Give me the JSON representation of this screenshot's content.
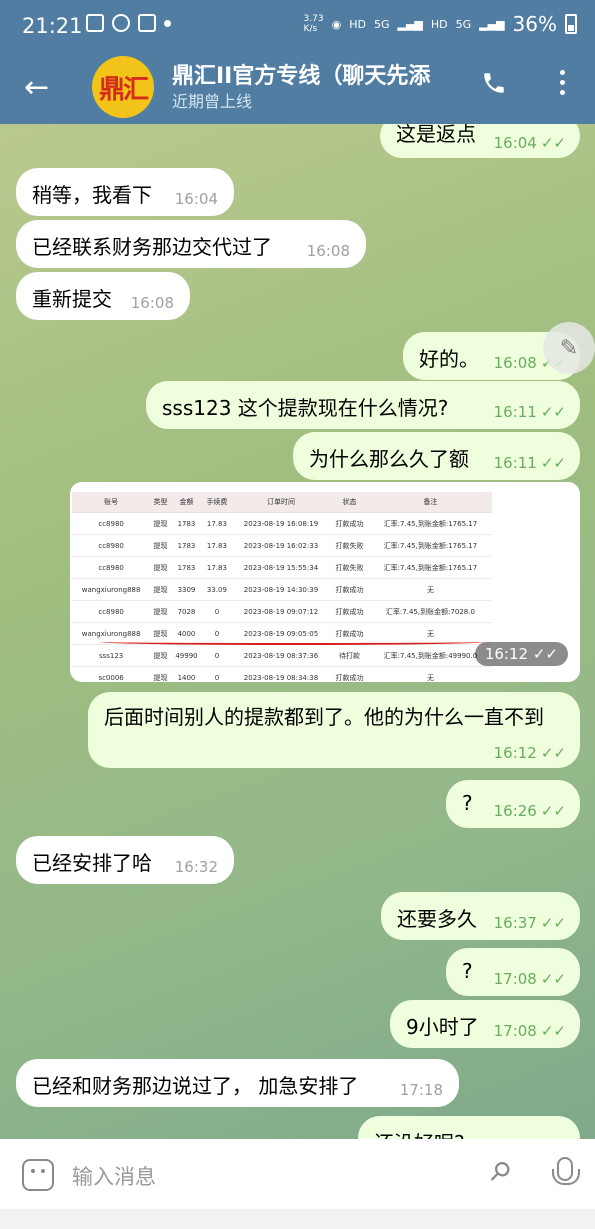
{
  "status_bar": {
    "time": "21:21",
    "net_speed": "3.73\nK/s",
    "hd1": "HD",
    "g5": "5G",
    "hd2": "HD",
    "g5b": "5G",
    "battery": "36%"
  },
  "header": {
    "title": "鼎汇II官方专线（聊天先添",
    "subtitle": "近期曾上线",
    "avatar_text": "鼎汇"
  },
  "colors": {
    "header": "#517da2",
    "out_bubble": "#effedd",
    "in_bubble": "#ffffff",
    "read_tick": "#6aac5e"
  },
  "messages": [
    {
      "dir": "out",
      "text": "这是返点",
      "time": "16:04"
    },
    {
      "dir": "in",
      "text": "稍等，我看下",
      "time": "16:04"
    },
    {
      "dir": "in",
      "text": "已经联系财务那边交代过了",
      "time": "16:08"
    },
    {
      "dir": "in",
      "text": "重新提交",
      "time": "16:08"
    },
    {
      "dir": "out",
      "text": "好的。",
      "time": "16:08"
    },
    {
      "dir": "out",
      "text": "sss123 这个提款现在什么情况?",
      "time": "16:11"
    },
    {
      "dir": "out",
      "text": "为什么那么久了额",
      "time": "16:11"
    },
    {
      "dir": "out",
      "text": "",
      "time": "16:12",
      "type": "image"
    },
    {
      "dir": "out",
      "text": "后面时间别人的提款都到了。他的为什么一直不到",
      "time": "16:12"
    },
    {
      "dir": "out",
      "text": "?",
      "time": "16:26"
    },
    {
      "dir": "in",
      "text": "已经安排了哈",
      "time": "16:32"
    },
    {
      "dir": "out",
      "text": "还要多久",
      "time": "16:37"
    },
    {
      "dir": "out",
      "text": "?",
      "time": "17:08"
    },
    {
      "dir": "out",
      "text": "9小时了",
      "time": "17:08"
    },
    {
      "dir": "in",
      "text": "已经和财务那边说过了， 加急安排了",
      "time": "17:18"
    },
    {
      "dir": "out",
      "text": "还没好呢?",
      "time": ""
    }
  ],
  "image_table": {
    "headers": [
      "账号",
      "类型",
      "金额",
      "手续费",
      "订单时间",
      "状态",
      "备注"
    ],
    "rows": [
      [
        "cc8980",
        "提现",
        "1783",
        "17.83",
        "2023-08-19 16:08:19",
        "打款成功",
        "汇率:7.45,到账金额:1765.17"
      ],
      [
        "cc8980",
        "提现",
        "1783",
        "17.83",
        "2023-08-19 16:02:33",
        "打款失败",
        "汇率:7.45,到账金额:1765.17"
      ],
      [
        "cc8980",
        "提现",
        "1783",
        "17.83",
        "2023-08-19 15:55:34",
        "打款失败",
        "汇率:7.45,到账金额:1765.17"
      ],
      [
        "wangxiurong888",
        "提现",
        "3309",
        "33.09",
        "2023-08-19 14:30:39",
        "打款成功",
        "无"
      ],
      [
        "cc8980",
        "提现",
        "7028",
        "0",
        "2023-08-19 09:07:12",
        "打款成功",
        "汇率:7.45,到账金额:7028.0"
      ],
      [
        "wangxiurong888",
        "提现",
        "4000",
        "0",
        "2023-08-19 09:05:05",
        "打款成功",
        "无"
      ],
      [
        "sss123",
        "提现",
        "49990",
        "0",
        "2023-08-19 08:37:36",
        "待打款",
        "汇率:7.45,到账金额:49990.0"
      ],
      [
        "sc0006",
        "提现",
        "1400",
        "0",
        "2023-08-19 08:34:38",
        "打款成功",
        "无"
      ]
    ]
  },
  "composer": {
    "placeholder": "输入消息"
  }
}
